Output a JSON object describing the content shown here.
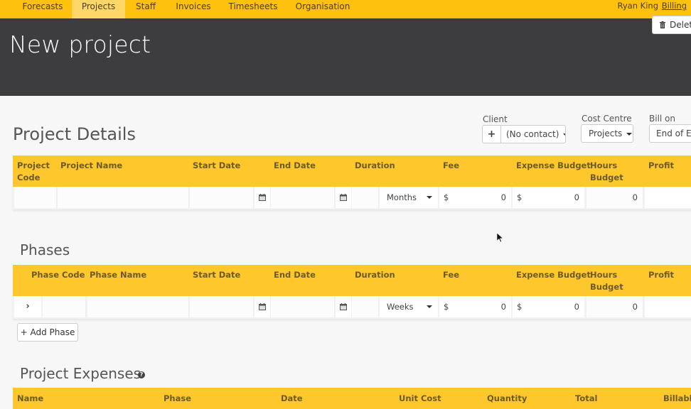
{
  "nav": {
    "tabs": [
      {
        "label": "Forecasts",
        "active": false
      },
      {
        "label": "Projects",
        "active": true
      },
      {
        "label": "Staff",
        "active": false
      },
      {
        "label": "Invoices",
        "active": false
      },
      {
        "label": "Timesheets",
        "active": false
      },
      {
        "label": "Organisation",
        "active": false
      }
    ],
    "user": "Ryan King",
    "billing": "Billing"
  },
  "header": {
    "title": "New project",
    "delete_label": "Delete"
  },
  "project_details": {
    "title": "Project Details",
    "client": {
      "label": "Client",
      "add_icon": "plus-icon",
      "value": "(No contact)"
    },
    "cost_centre": {
      "label": "Cost Centre",
      "value": "Projects"
    },
    "bill_on": {
      "label": "Bill on",
      "value": "End of Each Month"
    },
    "columns": [
      "Project Code",
      "Project Name",
      "Start Date",
      "End Date",
      "Duration",
      "Fee",
      "Expense Budget",
      "Hours Budget",
      "Profit"
    ],
    "row": {
      "project_code": "",
      "project_name": "",
      "start_date": "",
      "end_date": "",
      "duration": "",
      "duration_unit": "Months",
      "fee_currency": "$",
      "fee": "0",
      "expense_currency": "$",
      "expense_budget": "0",
      "hours_budget": "0",
      "profit": ""
    }
  },
  "phases": {
    "title": "Phases",
    "columns": [
      "Phase Code",
      "Phase Name",
      "Start Date",
      "End Date",
      "Duration",
      "Fee",
      "Expense Budget",
      "Hours Budget",
      "Profit"
    ],
    "row": {
      "expand_icon": "chevron-right-icon",
      "phase_code": "",
      "phase_name": "",
      "start_date": "",
      "end_date": "",
      "duration": "",
      "duration_unit": "Weeks",
      "fee_currency": "$",
      "fee": "0",
      "expense_currency": "$",
      "expense_budget": "0",
      "hours_budget": "0",
      "profit": ""
    },
    "add_label": "+ Add Phase"
  },
  "expenses": {
    "title": "Project Expenses",
    "help_icon": "?",
    "columns": [
      "Name",
      "Phase",
      "Date",
      "Unit Cost",
      "Quantity",
      "Total",
      "Billable"
    ]
  }
}
